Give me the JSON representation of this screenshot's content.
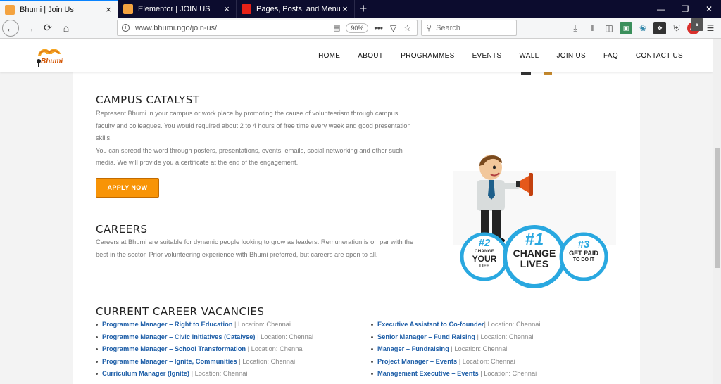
{
  "tabs": [
    {
      "label": "Bhumi | Join Us",
      "active": true
    },
    {
      "label": "Elementor | JOIN US",
      "active": false
    },
    {
      "label": "Pages, Posts, and Menus - Wo",
      "active": false
    }
  ],
  "newtab_label": "+",
  "tab_close_label": "×",
  "toolbar": {
    "back": "←",
    "forward": "→",
    "reload": "⟳",
    "home": "⌂",
    "url": "www.bhumi.ngo/join-us/",
    "zoom": "90%",
    "search_placeholder": "Search",
    "more": "•••"
  },
  "addon_badge": "6",
  "site": {
    "logo_text": "Bhumi",
    "menu": [
      "HOME",
      "ABOUT",
      "PROGRAMMES",
      "EVENTS",
      "WALL",
      "JOIN US",
      "FAQ",
      "CONTACT US"
    ]
  },
  "campus": {
    "title": "CAMPUS CATALYST",
    "lines": [
      "Represent Bhumi in your campus or work place by promoting the cause of volunteerism through campus",
      "faculty and colleagues. You would required about 2 to 4 hours of free time every week and good presentation",
      "skills.",
      "You can spread the word through posters, presentations, events, emails, social networking and other such",
      "media. We will provide you a certificate at the end of the engagement."
    ],
    "button": "APPLY NOW"
  },
  "careers": {
    "title": "CAREERS",
    "lines": [
      "Careers at Bhumi are suitable for dynamic people looking to grow as leaders. Remuneration is on par with the",
      "best in the sector. Prior volunteering experience with Bhumi preferred, but careers are open to all."
    ],
    "badges": [
      {
        "num": "#2",
        "l1": "CHANGE",
        "l2": "YOUR",
        "l3": "LIFE"
      },
      {
        "num": "#1",
        "l1": "CHANGE",
        "l2": "LIVES",
        "l3": ""
      },
      {
        "num": "#3",
        "l1": "GET PAID",
        "l2": "TO DO IT",
        "l3": ""
      }
    ]
  },
  "vacancies": {
    "title": "CURRENT CAREER VACANCIES",
    "left": [
      {
        "role": "Programme Manager – Right to Education",
        "loc": " | Location: Chennai"
      },
      {
        "role": "Programme Manager – Civic initiatives (Catalyse)",
        "loc": " | Location: Chennai"
      },
      {
        "role": "Programme Manager – School Transformation",
        "loc": " | Location: Chennai"
      },
      {
        "role": "Programme Manager – Ignite, Communities",
        "loc": " | Location: Chennai"
      },
      {
        "role": "Curriculum Manager (Ignite)",
        "loc": " | Location: Chennai"
      }
    ],
    "right": [
      {
        "role": "Executive Assistant to Co-founder",
        "loc": "| Location: Chennai"
      },
      {
        "role": "Senior Manager – Fund Raising",
        "loc": " | Location: Chennai"
      },
      {
        "role": "Manager – Fundraising",
        "loc": " | Location: Chennai"
      },
      {
        "role": "Project Manager – Events",
        "loc": " | Location: Chennai"
      },
      {
        "role": "Management Executive – Events",
        "loc": " | Location: Chennai"
      }
    ]
  },
  "colors": {
    "accent": "#f89406",
    "link": "#1f5fa8",
    "badge_blue": "#29a8e0"
  }
}
